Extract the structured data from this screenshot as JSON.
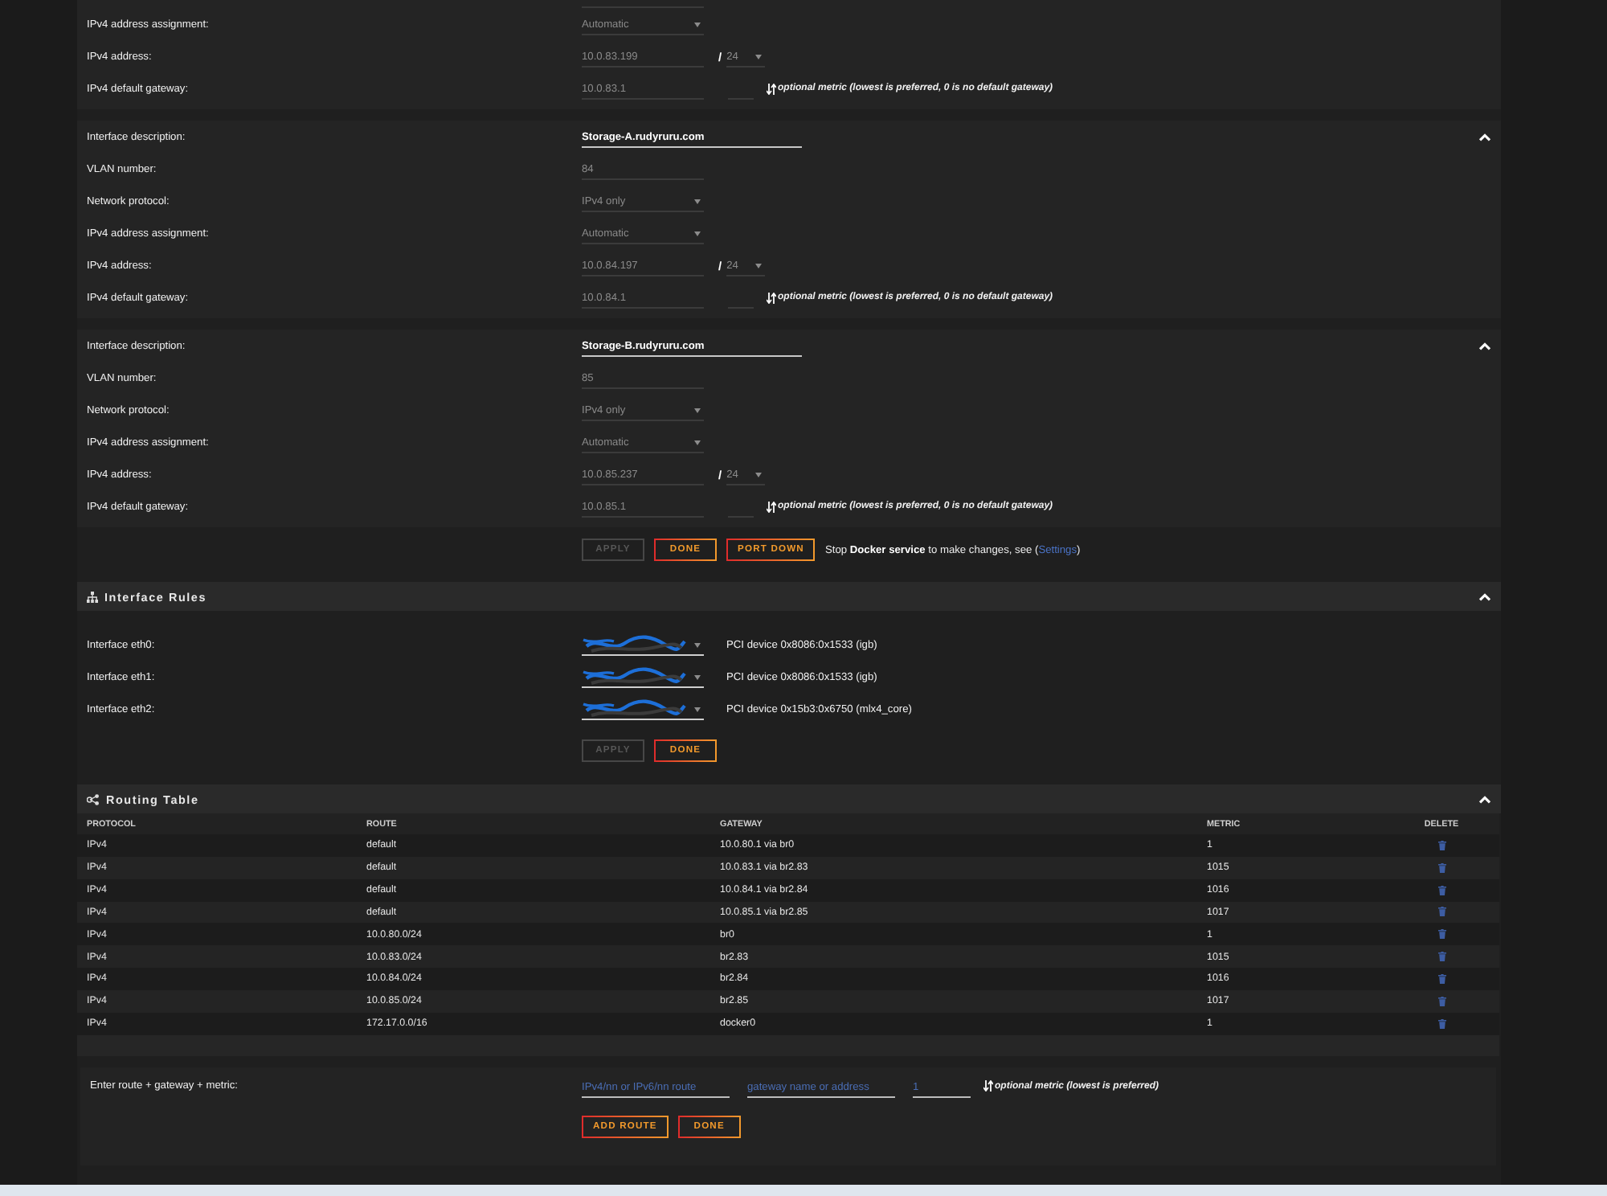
{
  "interfaces": [
    {
      "rows": [
        {
          "kind": "select",
          "label": "IPv4 address assignment:",
          "value": "Automatic",
          "disabled": true
        },
        {
          "kind": "address",
          "label": "IPv4 address:",
          "value": "10.0.83.199",
          "disabled": true,
          "separator": "/",
          "prefix": "24"
        },
        {
          "kind": "gateway",
          "label": "IPv4 default gateway:",
          "value": "10.0.83.1",
          "disabled": true,
          "hint": "optional metric (lowest is preferred, 0 is no default gateway)"
        }
      ]
    },
    {
      "expanded": true,
      "rows": [
        {
          "kind": "description",
          "label": "Interface description:",
          "value": "Storage-A.rudyruru.com",
          "disabled": false
        },
        {
          "kind": "text",
          "label": "VLAN number:",
          "value": "84",
          "disabled": true
        },
        {
          "kind": "select",
          "label": "Network protocol:",
          "value": "IPv4 only",
          "disabled": true
        },
        {
          "kind": "select",
          "label": "IPv4 address assignment:",
          "value": "Automatic",
          "disabled": true
        },
        {
          "kind": "address",
          "label": "IPv4 address:",
          "value": "10.0.84.197",
          "disabled": true,
          "separator": "/",
          "prefix": "24"
        },
        {
          "kind": "gateway",
          "label": "IPv4 default gateway:",
          "value": "10.0.84.1",
          "disabled": true,
          "hint": "optional metric (lowest is preferred, 0 is no default gateway)"
        }
      ]
    },
    {
      "expanded": true,
      "rows": [
        {
          "kind": "description",
          "label": "Interface description:",
          "value": "Storage-B.rudyruru.com",
          "disabled": false
        },
        {
          "kind": "text",
          "label": "VLAN number:",
          "value": "85",
          "disabled": true
        },
        {
          "kind": "select",
          "label": "Network protocol:",
          "value": "IPv4 only",
          "disabled": true
        },
        {
          "kind": "select",
          "label": "IPv4 address assignment:",
          "value": "Automatic",
          "disabled": true
        },
        {
          "kind": "address",
          "label": "IPv4 address:",
          "value": "10.0.85.237",
          "disabled": true,
          "separator": "/",
          "prefix": "24"
        },
        {
          "kind": "gateway",
          "label": "IPv4 default gateway:",
          "value": "10.0.85.1",
          "disabled": true,
          "hint": "optional metric (lowest is preferred, 0 is no default gateway)"
        }
      ]
    }
  ],
  "interface_actions": {
    "buttons": [
      {
        "label": "APPLY",
        "disabled": true
      },
      {
        "label": "DONE",
        "disabled": false
      },
      {
        "label": "PORT DOWN",
        "disabled": false
      }
    ],
    "note": {
      "text": "Stop **Docker service** to make changes, see (",
      "link": "Settings",
      "after": ")"
    }
  },
  "interface_rules": {
    "title": "Interface Rules",
    "expanded": true,
    "rows": [
      {
        "label": "Interface eth0:",
        "device": "PCI device 0x8086:0x1533 (igb)"
      },
      {
        "label": "Interface eth1:",
        "device": "PCI device 0x8086:0x1533 (igb)"
      },
      {
        "label": "Interface eth2:",
        "device": "PCI device 0x15b3:0x6750 (mlx4_core)"
      }
    ],
    "buttons": [
      {
        "label": "APPLY",
        "disabled": true
      },
      {
        "label": "DONE",
        "disabled": false
      }
    ]
  },
  "routing_table": {
    "title": "Routing Table",
    "expanded": true,
    "columns": [
      "PROTOCOL",
      "ROUTE",
      "GATEWAY",
      "METRIC",
      "DELETE"
    ],
    "rows": [
      {
        "protocol": "IPv4",
        "route": "default",
        "gateway": "10.0.80.1 via br0",
        "metric": "1"
      },
      {
        "protocol": "IPv4",
        "route": "default",
        "gateway": "10.0.83.1 via br2.83",
        "metric": "1015"
      },
      {
        "protocol": "IPv4",
        "route": "default",
        "gateway": "10.0.84.1 via br2.84",
        "metric": "1016"
      },
      {
        "protocol": "IPv4",
        "route": "default",
        "gateway": "10.0.85.1 via br2.85",
        "metric": "1017"
      },
      {
        "protocol": "IPv4",
        "route": "10.0.80.0/24",
        "gateway": "br0",
        "metric": "1"
      },
      {
        "protocol": "IPv4",
        "route": "10.0.83.0/24",
        "gateway": "br2.83",
        "metric": "1015"
      },
      {
        "protocol": "IPv4",
        "route": "10.0.84.0/24",
        "gateway": "br2.84",
        "metric": "1016"
      },
      {
        "protocol": "IPv4",
        "route": "10.0.85.0/24",
        "gateway": "br2.85",
        "metric": "1017"
      },
      {
        "protocol": "IPv4",
        "route": "172.17.0.0/16",
        "gateway": "docker0",
        "metric": "1"
      }
    ]
  },
  "add_route": {
    "label": "Enter route + gateway + metric:",
    "fields": [
      {
        "kind": "route",
        "placeholder": "IPv4/nn or IPv6/nn route"
      },
      {
        "kind": "gateway",
        "placeholder": "gateway name or address"
      },
      {
        "kind": "metric",
        "placeholder": "1"
      }
    ],
    "hint": "optional metric (lowest is preferred)",
    "buttons": [
      {
        "label": "ADD ROUTE",
        "disabled": false
      },
      {
        "label": "DONE",
        "disabled": false
      }
    ]
  }
}
